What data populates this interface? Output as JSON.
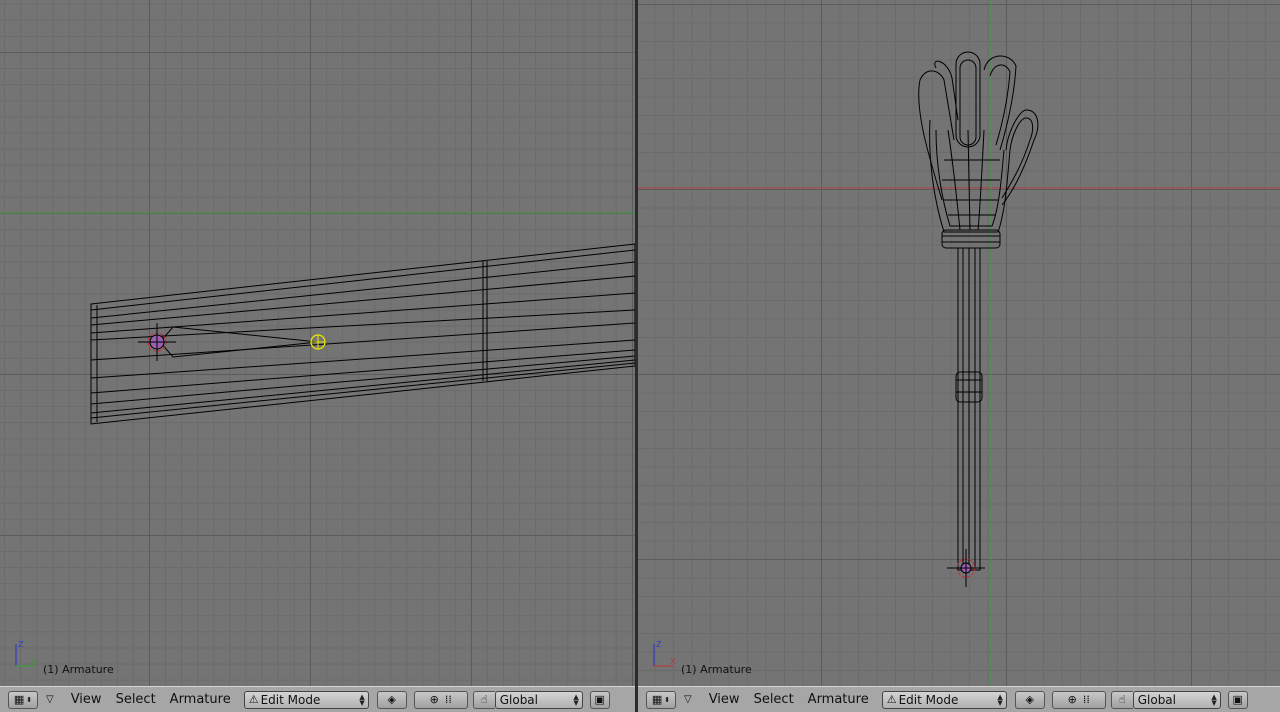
{
  "left_view": {
    "object_label": "(1) Armature",
    "axis_a": "Z",
    "axis_b": "Y"
  },
  "right_view": {
    "object_label": "(1) Armature",
    "axis_a": "Z",
    "axis_b": "X"
  },
  "header_left": {
    "menu_view": "View",
    "menu_select": "Select",
    "menu_armature": "Armature",
    "mode": "Edit Mode",
    "orientation": "Global"
  },
  "header_right": {
    "menu_view": "View",
    "menu_select": "Select",
    "menu_armature": "Armature",
    "mode": "Edit Mode",
    "orientation": "Global"
  },
  "colors": {
    "grid_bg": "#747474",
    "x_axis": "#b04040",
    "y_axis": "#3f9a3f",
    "header_bg": "#a6a6a6",
    "bone_tip": "#e6e600"
  }
}
